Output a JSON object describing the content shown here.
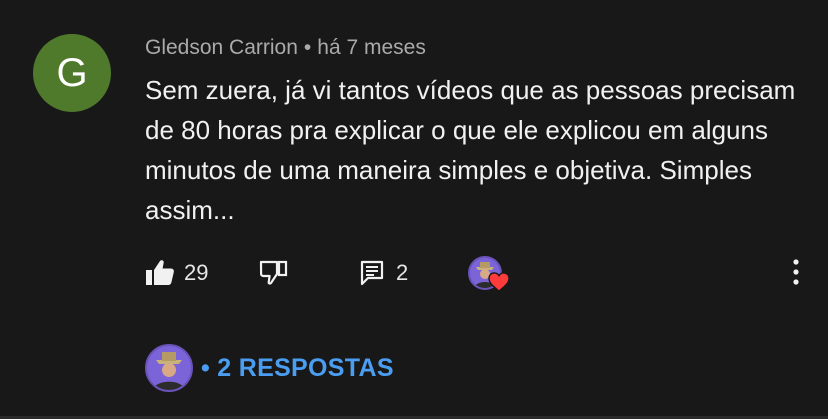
{
  "comment": {
    "avatar_letter": "G",
    "author": "Gledson Carrion",
    "separator": "•",
    "time": "há 7 meses",
    "text": "Sem zuera, já vi tantos vídeos que as pessoas precisam de 80 horas pra explicar o que ele explicou em alguns minutos de uma maneira simples e objetiva. Simples assim..."
  },
  "actions": {
    "like_icon": "thumbs-up-icon",
    "like_count": "29",
    "dislike_icon": "thumbs-down-icon",
    "reply_icon": "comment-icon",
    "reply_count": "2",
    "creator_heart_icon": "heart-icon",
    "more_icon": "more-vertical-icon"
  },
  "replies": {
    "label": "• 2 RESPOSTAS"
  },
  "colors": {
    "background": "#181818",
    "avatar_bg": "#4f7a2b",
    "link": "#4a9df0",
    "heart": "#ff3b3b"
  }
}
